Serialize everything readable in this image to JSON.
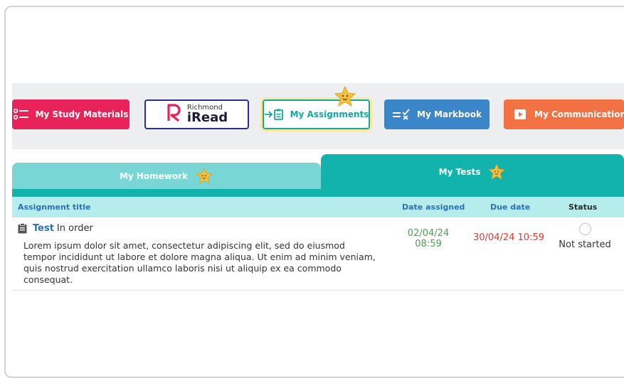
{
  "nav": {
    "study_materials": "My Study Materials",
    "iread_top": "Richmond",
    "iread_main": "iRead",
    "assignments": "My Assignments",
    "markbook": "My Markbook",
    "communications": "My Communications"
  },
  "tabs": {
    "homework": "My Homework",
    "tests": "My Tests",
    "active": "tests"
  },
  "table": {
    "headers": {
      "title": "Assignment title",
      "date_assigned": "Date assigned",
      "due_date": "Due date",
      "status": "Status"
    },
    "rows": [
      {
        "type": "Test",
        "name": "In order",
        "description": "Lorem ipsum dolor sit amet, consectetur adipiscing elit, sed do eiusmod tempor incididunt ut labore et dolore magna aliqua. Ut enim ad minim veniam, quis nostrud exercitation ullamco laboris nisi ut aliquip ex ea commodo consequat.",
        "date_assigned": "02/04/24",
        "time_assigned": "08:59",
        "due_date": "30/04/24 10:59",
        "status": "Not started"
      }
    ]
  },
  "colors": {
    "study": "#e8235a",
    "assignments": "#16a6a0",
    "markbook": "#3a86c9",
    "communications": "#f37243",
    "tab_active": "#13b3ad",
    "tab_inactive": "#78d6d4",
    "header_bg": "#b7eced"
  },
  "icons": {
    "study": "list-icon",
    "iread": "iread-logo",
    "assignments": "assignment-icon",
    "markbook": "markbook-icon",
    "communications": "play-icon",
    "star": "star-mascot-icon",
    "row": "clipboard-icon"
  }
}
